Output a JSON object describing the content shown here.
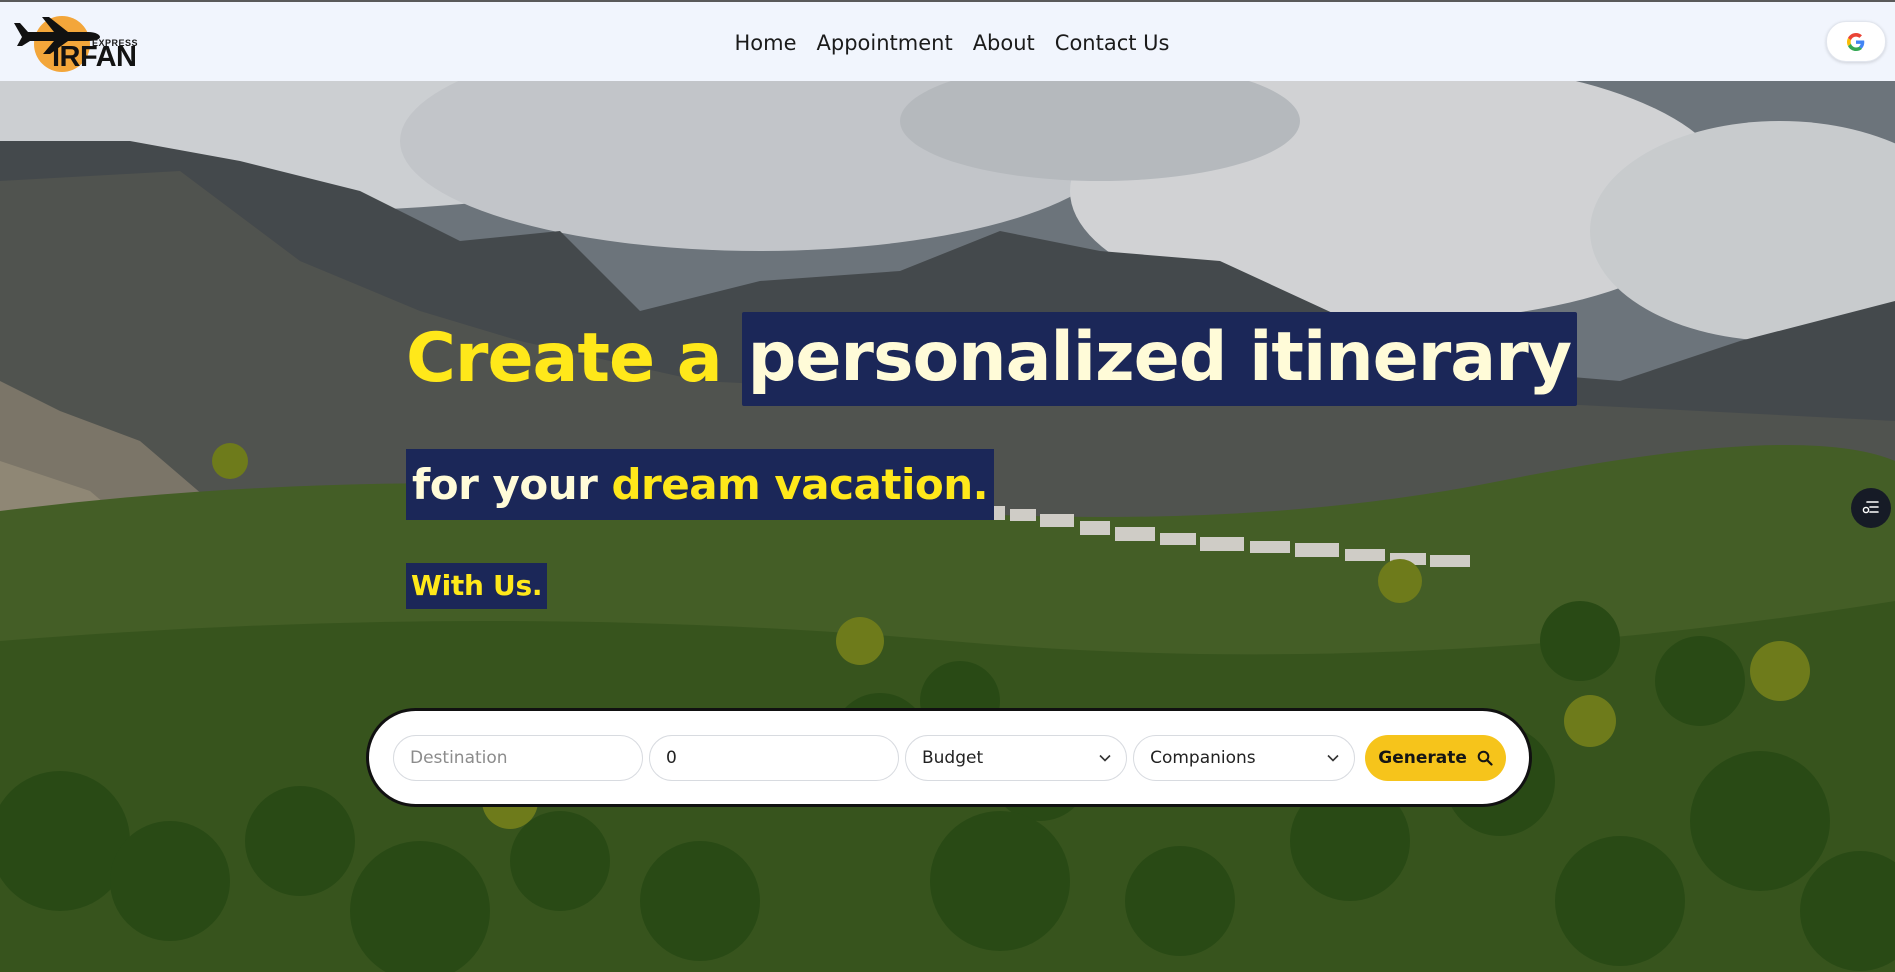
{
  "brand": {
    "top_text": "EXPRESS",
    "name": "IRFAN",
    "logo_icon": "airplane-sun-icon"
  },
  "nav": {
    "items": [
      {
        "label": "Home"
      },
      {
        "label": "Appointment"
      },
      {
        "label": "About"
      },
      {
        "label": "Contact Us"
      }
    ]
  },
  "auth": {
    "google_icon": "google-icon"
  },
  "hero": {
    "line1_plain": "Create a",
    "line1_highlight": "personalized itinerary",
    "line2_plain": "for your",
    "line2_highlight": "dream vacation.",
    "line3": "With Us.",
    "side_icon": "filter-list-icon"
  },
  "search": {
    "destination_placeholder": "Destination",
    "days_value": "0",
    "budget_label": "Budget",
    "companions_label": "Companions",
    "generate_label": "Generate",
    "generate_icon": "search-icon"
  },
  "colors": {
    "accent_yellow": "#ffe81a",
    "highlight_navy": "#1b2758",
    "button_yellow": "#f6c41b",
    "header_bg": "#f1f5fd"
  }
}
